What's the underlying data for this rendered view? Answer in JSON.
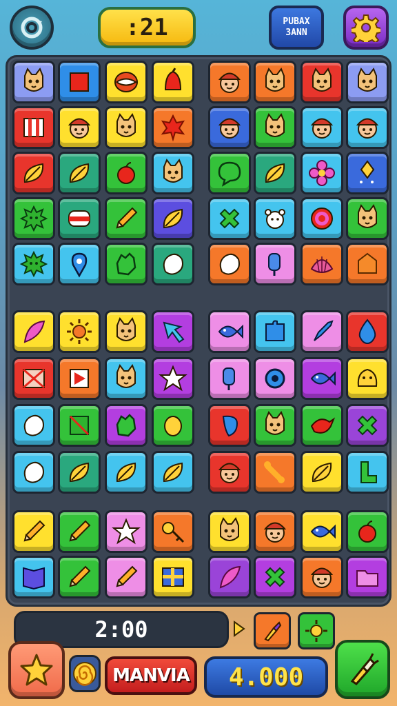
{
  "header": {
    "timer": ":21",
    "badge_line1": "PUBAX",
    "badge_line2": "3ANN",
    "colors": {
      "timer": "#ffe14a",
      "badge": "#3d78e0",
      "settings": "#9b4ce0"
    }
  },
  "board": {
    "colors": {
      "red": "#e8352c",
      "blue": "#2f8ee8",
      "yellow": "#ffe02e",
      "orange": "#f5782a",
      "green": "#34c23a",
      "teal": "#2aa87e",
      "sky": "#44c4ee",
      "purple": "#b33ee0",
      "pink": "#ee8ee6",
      "lilac": "#8c9cf2",
      "navy": "#3a6adc",
      "dgreen": "#2f9c4a",
      "violet": "#9a44d8",
      "indigo": "#5c4ee0"
    },
    "tiles": [
      {
        "color": "lilac",
        "icon": "cat-face"
      },
      {
        "color": "blue",
        "icon": "red-square"
      },
      {
        "color": "yellow",
        "icon": "ball"
      },
      {
        "color": "yellow",
        "icon": "bell"
      },
      {
        "color": "orange",
        "icon": "face"
      },
      {
        "color": "orange",
        "icon": "cat-face"
      },
      {
        "color": "red",
        "icon": "cat-face"
      },
      {
        "color": "lilac",
        "icon": "cat-face"
      },
      {
        "color": "red",
        "icon": "gate"
      },
      {
        "color": "yellow",
        "icon": "face"
      },
      {
        "color": "yellow",
        "icon": "cat-face"
      },
      {
        "color": "orange",
        "icon": "leaf-red"
      },
      {
        "color": "navy",
        "icon": "face"
      },
      {
        "color": "green",
        "icon": "cat-face"
      },
      {
        "color": "sky",
        "icon": "face"
      },
      {
        "color": "sky",
        "icon": "face"
      },
      {
        "color": "red",
        "icon": "leaf"
      },
      {
        "color": "teal",
        "icon": "leaf"
      },
      {
        "color": "green",
        "icon": "apple"
      },
      {
        "color": "sky",
        "icon": "cat-face"
      },
      {
        "color": "green",
        "icon": "bubble"
      },
      {
        "color": "teal",
        "icon": "leaf"
      },
      {
        "color": "sky",
        "icon": "flower"
      },
      {
        "color": "navy",
        "icon": "kite"
      },
      {
        "color": "green",
        "icon": "splat"
      },
      {
        "color": "teal",
        "icon": "stripe"
      },
      {
        "color": "green",
        "icon": "pencil"
      },
      {
        "color": "indigo",
        "icon": "leaf"
      },
      {
        "color": "sky",
        "icon": "cross"
      },
      {
        "color": "sky",
        "icon": "bear"
      },
      {
        "color": "sky",
        "icon": "target"
      },
      {
        "color": "green",
        "icon": "cat-face"
      },
      {
        "color": "sky",
        "icon": "splat"
      },
      {
        "color": "sky",
        "icon": "pin"
      },
      {
        "color": "green",
        "icon": "hand"
      },
      {
        "color": "teal",
        "icon": "blob"
      },
      {
        "color": "orange",
        "icon": "blob"
      },
      {
        "color": "pink",
        "icon": "lolly"
      },
      {
        "color": "orange",
        "icon": "shell"
      },
      {
        "color": "orange",
        "icon": "house"
      },
      {
        "color": "yellow",
        "icon": "feather"
      },
      {
        "color": "yellow",
        "icon": "sun"
      },
      {
        "color": "yellow",
        "icon": "cat-face"
      },
      {
        "color": "purple",
        "icon": "arrow"
      },
      {
        "color": "pink",
        "icon": "fish"
      },
      {
        "color": "sky",
        "icon": "puzzle"
      },
      {
        "color": "pink",
        "icon": "rocket"
      },
      {
        "color": "red",
        "icon": "drop"
      },
      {
        "color": "red",
        "icon": "envelope"
      },
      {
        "color": "orange",
        "icon": "flag"
      },
      {
        "color": "sky",
        "icon": "cat-face"
      },
      {
        "color": "purple",
        "icon": "star"
      },
      {
        "color": "pink",
        "icon": "lolly"
      },
      {
        "color": "pink",
        "icon": "ring"
      },
      {
        "color": "purple",
        "icon": "fish"
      },
      {
        "color": "yellow",
        "icon": "chick"
      },
      {
        "color": "sky",
        "icon": "blob"
      },
      {
        "color": "green",
        "icon": "box"
      },
      {
        "color": "purple",
        "icon": "hand"
      },
      {
        "color": "green",
        "icon": "egg"
      },
      {
        "color": "red",
        "icon": "spin"
      },
      {
        "color": "green",
        "icon": "cat-face"
      },
      {
        "color": "green",
        "icon": "bird"
      },
      {
        "color": "violet",
        "icon": "cross"
      },
      {
        "color": "sky",
        "icon": "blob"
      },
      {
        "color": "teal",
        "icon": "leaf"
      },
      {
        "color": "sky",
        "icon": "leaf"
      },
      {
        "color": "sky",
        "icon": "leaf"
      },
      {
        "color": "red",
        "icon": "face"
      },
      {
        "color": "orange",
        "icon": "bone"
      },
      {
        "color": "yellow",
        "icon": "leaf"
      },
      {
        "color": "sky",
        "icon": "boot"
      },
      {
        "color": "yellow",
        "icon": "pencil"
      },
      {
        "color": "green",
        "icon": "pencil"
      },
      {
        "color": "pink",
        "icon": "star"
      },
      {
        "color": "orange",
        "icon": "key"
      },
      {
        "color": "yellow",
        "icon": "cat-face"
      },
      {
        "color": "orange",
        "icon": "face"
      },
      {
        "color": "yellow",
        "icon": "fish"
      },
      {
        "color": "green",
        "icon": "apple"
      },
      {
        "color": "sky",
        "icon": "book"
      },
      {
        "color": "green",
        "icon": "pencil"
      },
      {
        "color": "pink",
        "icon": "pencil"
      },
      {
        "color": "yellow",
        "icon": "flag-grid"
      },
      {
        "color": "violet",
        "icon": "feather"
      },
      {
        "color": "purple",
        "icon": "cross"
      },
      {
        "color": "orange",
        "icon": "face"
      },
      {
        "color": "purple",
        "icon": "folder"
      }
    ]
  },
  "footer": {
    "time": "2:00",
    "name_label": "MANVIA",
    "score": "4.000"
  }
}
